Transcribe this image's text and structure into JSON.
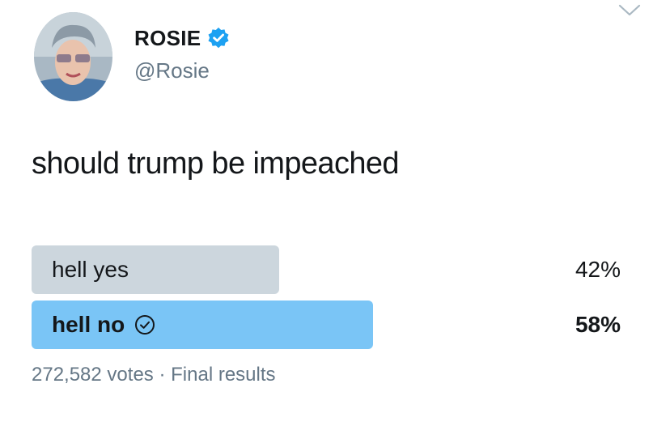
{
  "author": {
    "name": "ROSIE",
    "handle": "@Rosie",
    "verified": true
  },
  "tweet": {
    "text": "should trump be impeached"
  },
  "poll": {
    "options": [
      {
        "label": "hell yes",
        "percent_text": "42%",
        "percent": 42,
        "winner": false,
        "bar_color": "#ccd6dd"
      },
      {
        "label": "hell no",
        "percent_text": "58%",
        "percent": 58,
        "winner": true,
        "bar_color": "#7ac5f6"
      }
    ],
    "votes": "272,582 votes",
    "separator": "·",
    "status": "Final results"
  },
  "icons": {
    "verified": "verified-badge-icon",
    "winner_check": "check-circle-icon",
    "menu": "chevron-down-icon"
  },
  "colors": {
    "verified_blue": "#1da1f2",
    "secondary_text": "#657786"
  }
}
